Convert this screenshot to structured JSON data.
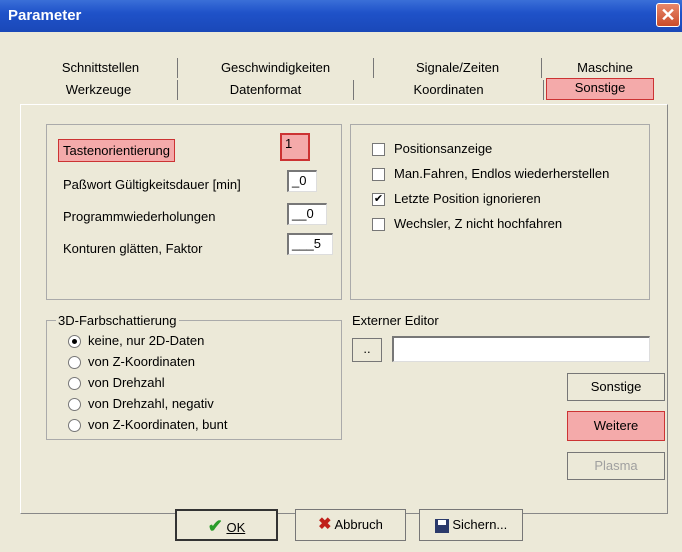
{
  "window": {
    "title": "Parameter",
    "close_glyph": "✕"
  },
  "tabs": {
    "row1": [
      "Schnittstellen",
      "Geschwindigkeiten",
      "Signale/Zeiten",
      "Maschine"
    ],
    "row2": [
      "Werkzeuge",
      "Datenformat",
      "Koordinaten",
      "Sonstige"
    ],
    "selected": "Sonstige"
  },
  "fields": [
    {
      "label": "Tastenorientierung",
      "value": "1"
    },
    {
      "label": "Paßwort Gültigkeitsdauer [min]",
      "value": "_0"
    },
    {
      "label": "Programmwiederholungen",
      "value": "__0"
    },
    {
      "label": "Konturen glätten, Faktor",
      "value": "___5"
    }
  ],
  "checkboxes": [
    {
      "label": "Positionsanzeige",
      "checked": false
    },
    {
      "label": "Man.Fahren, Endlos wiederherstellen",
      "checked": false
    },
    {
      "label": "Letzte Position ignorieren",
      "checked": true
    },
    {
      "label": "Wechsler, Z nicht hochfahren",
      "checked": false
    }
  ],
  "shading": {
    "legend": "3D-Farbschattierung",
    "options": [
      "keine, nur 2D-Daten",
      "von Z-Koordinaten",
      "von Drehzahl",
      "von Drehzahl, negativ",
      "von Z-Koordinaten, bunt"
    ],
    "selected_index": 0
  },
  "editor": {
    "label": "Externer Editor",
    "browse": "..",
    "value": ""
  },
  "side_buttons": {
    "sonstige": "Sonstige",
    "weitere": "Weitere",
    "plasma": "Plasma"
  },
  "footer": {
    "ok": "OK",
    "abbruch": "Abbruch",
    "sichern": "Sichern..."
  },
  "icons": {
    "check_glyph": "✔",
    "x_glyph": "✖",
    "ok_icon": "check-icon",
    "abbruch_icon": "x-icon",
    "sichern_icon": "floppy-disk-icon"
  },
  "colors": {
    "highlight": "#f4aaaa",
    "highlight_border": "#cc3333",
    "titlebar": "#1f52c9",
    "ok_green": "#2a9d2a",
    "abbruch_red": "#c0201a"
  }
}
